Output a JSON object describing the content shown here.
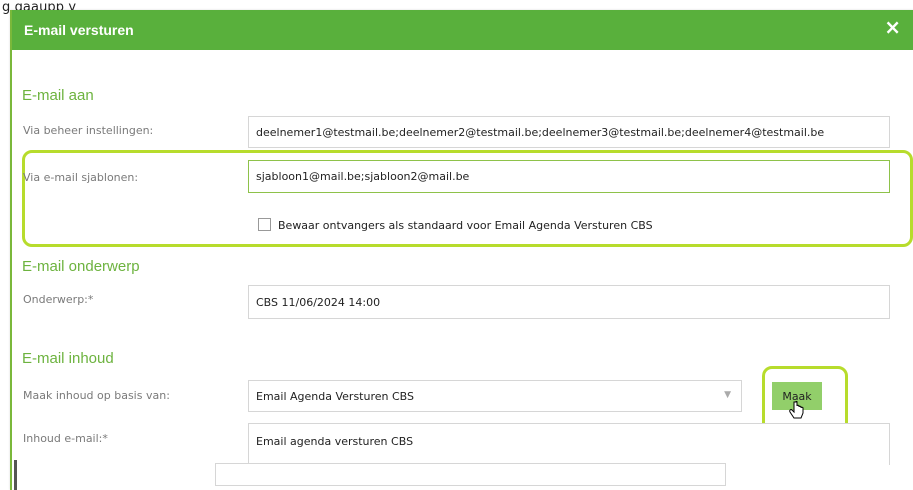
{
  "background_text": "g                                               gaaupp      y",
  "dialog": {
    "title": "E-mail versturen",
    "close_glyph": "×"
  },
  "sections": {
    "email_aan": "E-mail aan",
    "email_onderwerp": "E-mail onderwerp",
    "email_inhoud": "E-mail inhoud"
  },
  "fields": {
    "via_beheer": {
      "label": "Via beheer instellingen:",
      "value": "deelnemer1@testmail.be;deelnemer2@testmail.be;deelnemer3@testmail.be;deelnemer4@testmail.be"
    },
    "via_sjablonen": {
      "label": "Via e-mail sjablonen:",
      "value": "sjabloon1@mail.be;sjabloon2@mail.be"
    },
    "bewaar": {
      "label": "Bewaar ontvangers als standaard voor Email Agenda Versturen CBS",
      "checked": false
    },
    "onderwerp": {
      "label": "Onderwerp:*",
      "value": "CBS 11/06/2024 14:00"
    },
    "maak_inhoud": {
      "label": "Maak inhoud op basis van:",
      "value": "Email Agenda Versturen CBS",
      "arrow": "▼"
    },
    "inhoud": {
      "label": "Inhoud e-mail:*",
      "value": "Email agenda versturen CBS"
    }
  },
  "buttons": {
    "maak": "Maak"
  },
  "colors": {
    "header": "#59b03c",
    "section_title": "#6db33f",
    "highlight": "#b7dc2c",
    "button": "#92cf6a"
  }
}
